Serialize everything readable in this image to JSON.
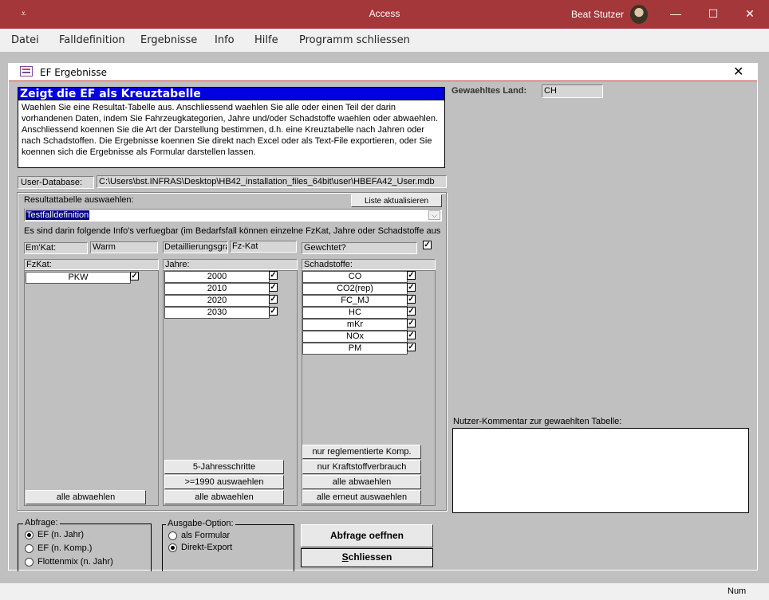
{
  "titlebar": {
    "quick_access_glyph": "⩡",
    "app_title": "Access",
    "user_name": "Beat Stutzer",
    "minimize": "—",
    "maximize": "☐",
    "close": "✕"
  },
  "menubar": {
    "items": [
      "Datei",
      "Falldefinition",
      "Ergebnisse",
      "Info",
      "Hilfe",
      "Programm schliessen"
    ]
  },
  "document": {
    "title": "EF Ergebnisse",
    "close": "✕"
  },
  "header": {
    "heading": "Zeigt die EF als Kreuztabelle",
    "description": "Waehlen Sie eine Resultat-Tabelle aus. Anschliessend waehlen Sie alle oder einen Teil der darin vorhandenen Daten, indem Sie Fahrzeugkategorien, Jahre und/oder Schadstoffe waehlen oder abwaehlen. Anschliessend koennen Sie die Art der Darstellung bestimmen, d.h. eine Kreuztabelle nach Jahren oder nach Schadstoffen. Die Ergebnisse koennen Sie direkt nach Excel oder als Text-File exportieren, oder Sie koennen sich die Ergebnisse als Formular darstellen lassen."
  },
  "land": {
    "label": "Gewaehltes Land:",
    "value": "CH"
  },
  "userdb": {
    "label": "User-Database:",
    "path": "C:\\Users\\bst.INFRAS\\Desktop\\HB42_installation_files_64bit\\user\\HBEFA42_User.mdb"
  },
  "result": {
    "label": "Resultattabelle auswaehlen:",
    "refresh_button": "Liste aktualisieren",
    "selected": "Testfalldefinition",
    "info": "Es sind darin folgende Info's verfuegbar (im Bedarfsfall können einzelne FzKat, Jahre oder Schadstoffe ausgebl"
  },
  "fields": {
    "emkat_label": "Em'Kat:",
    "emkat_value": "Warm",
    "detail_label": "Detaillierungsgrad",
    "detail_value": "Fz-Kat",
    "gewichtet_label": "Gewchtet?",
    "gewichtet_checked": true
  },
  "fzkat": {
    "header": "FzKat:",
    "items": [
      {
        "label": "PKW",
        "checked": true
      }
    ],
    "btn_none": "alle abwaehlen"
  },
  "jahre": {
    "header": "Jahre:",
    "items": [
      {
        "label": "2000",
        "checked": true
      },
      {
        "label": "2010",
        "checked": true
      },
      {
        "label": "2020",
        "checked": true
      },
      {
        "label": "2030",
        "checked": true
      }
    ],
    "btn_5y": "5-Jahresschritte",
    "btn_1990": ">=1990 auswaehlen",
    "btn_none": "alle abwaehlen"
  },
  "schadstoffe": {
    "header": "Schadstoffe:",
    "items": [
      {
        "label": "CO",
        "checked": true
      },
      {
        "label": "CO2(rep)",
        "checked": true
      },
      {
        "label": "FC_MJ",
        "checked": true
      },
      {
        "label": "HC",
        "checked": true
      },
      {
        "label": "mKr",
        "checked": true
      },
      {
        "label": "NOx",
        "checked": true
      },
      {
        "label": "PM",
        "checked": true
      }
    ],
    "btn_regl": "nur reglementierte Komp.",
    "btn_fuel": "nur Kraftstoffverbrauch",
    "btn_none": "alle abwaehlen",
    "btn_again": "alle erneut auswaehlen"
  },
  "comment": {
    "label": "Nutzer-Kommentar zur gewaehlten Tabelle:",
    "value": ""
  },
  "abfrage": {
    "legend": "Abfrage:",
    "options": [
      {
        "label": "EF (n. Jahr)",
        "selected": true
      },
      {
        "label": "EF (n. Komp.)",
        "selected": false
      },
      {
        "label": "Flottenmix (n. Jahr)",
        "selected": false
      }
    ]
  },
  "ausgabe": {
    "legend": "Ausgabe-Option:",
    "options": [
      {
        "label": "als Formular",
        "selected": false
      },
      {
        "label": "Direkt-Export",
        "selected": true
      }
    ]
  },
  "actions": {
    "open": "Abfrage oeffnen",
    "close_first": "S",
    "close_rest": "chliessen"
  },
  "status": {
    "num": "Num"
  }
}
